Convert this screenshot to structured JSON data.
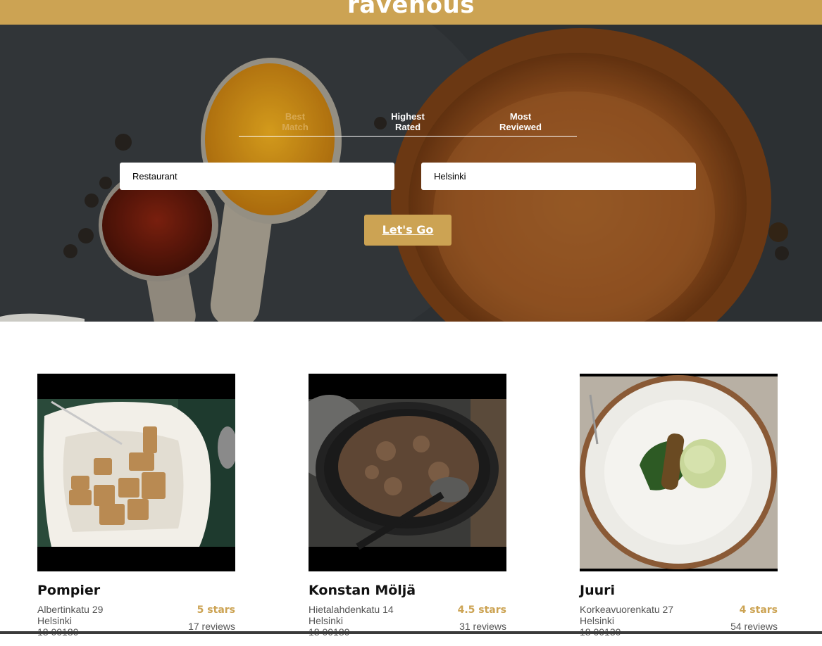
{
  "header": {
    "brand": "ravenous"
  },
  "sort_options": [
    {
      "line1": "Best",
      "line2": "Match",
      "active": true
    },
    {
      "line1": "Highest",
      "line2": "Rated",
      "active": false
    },
    {
      "line1": "Most",
      "line2": "Reviewed",
      "active": false
    }
  ],
  "search": {
    "term_value": "Restaurant",
    "location_value": "Helsinki",
    "submit_label": "Let's Go"
  },
  "businesses": [
    {
      "name": "Pompier",
      "address": "Albertinkatu 29",
      "city": "Helsinki",
      "zip": "18 00180",
      "rating": "5 stars",
      "reviews": "17 reviews"
    },
    {
      "name": "Konstan Möljä",
      "address": "Hietalahdenkatu 14",
      "city": "Helsinki",
      "zip": "18 00180",
      "rating": "4.5 stars",
      "reviews": "31 reviews"
    },
    {
      "name": "Juuri",
      "address": "Korkeavuorenkatu 27",
      "city": "Helsinki",
      "zip": "18 00130",
      "rating": "4 stars",
      "reviews": "54 reviews"
    }
  ],
  "colors": {
    "brand": "#cca353",
    "active_sort": "#d8a953"
  }
}
